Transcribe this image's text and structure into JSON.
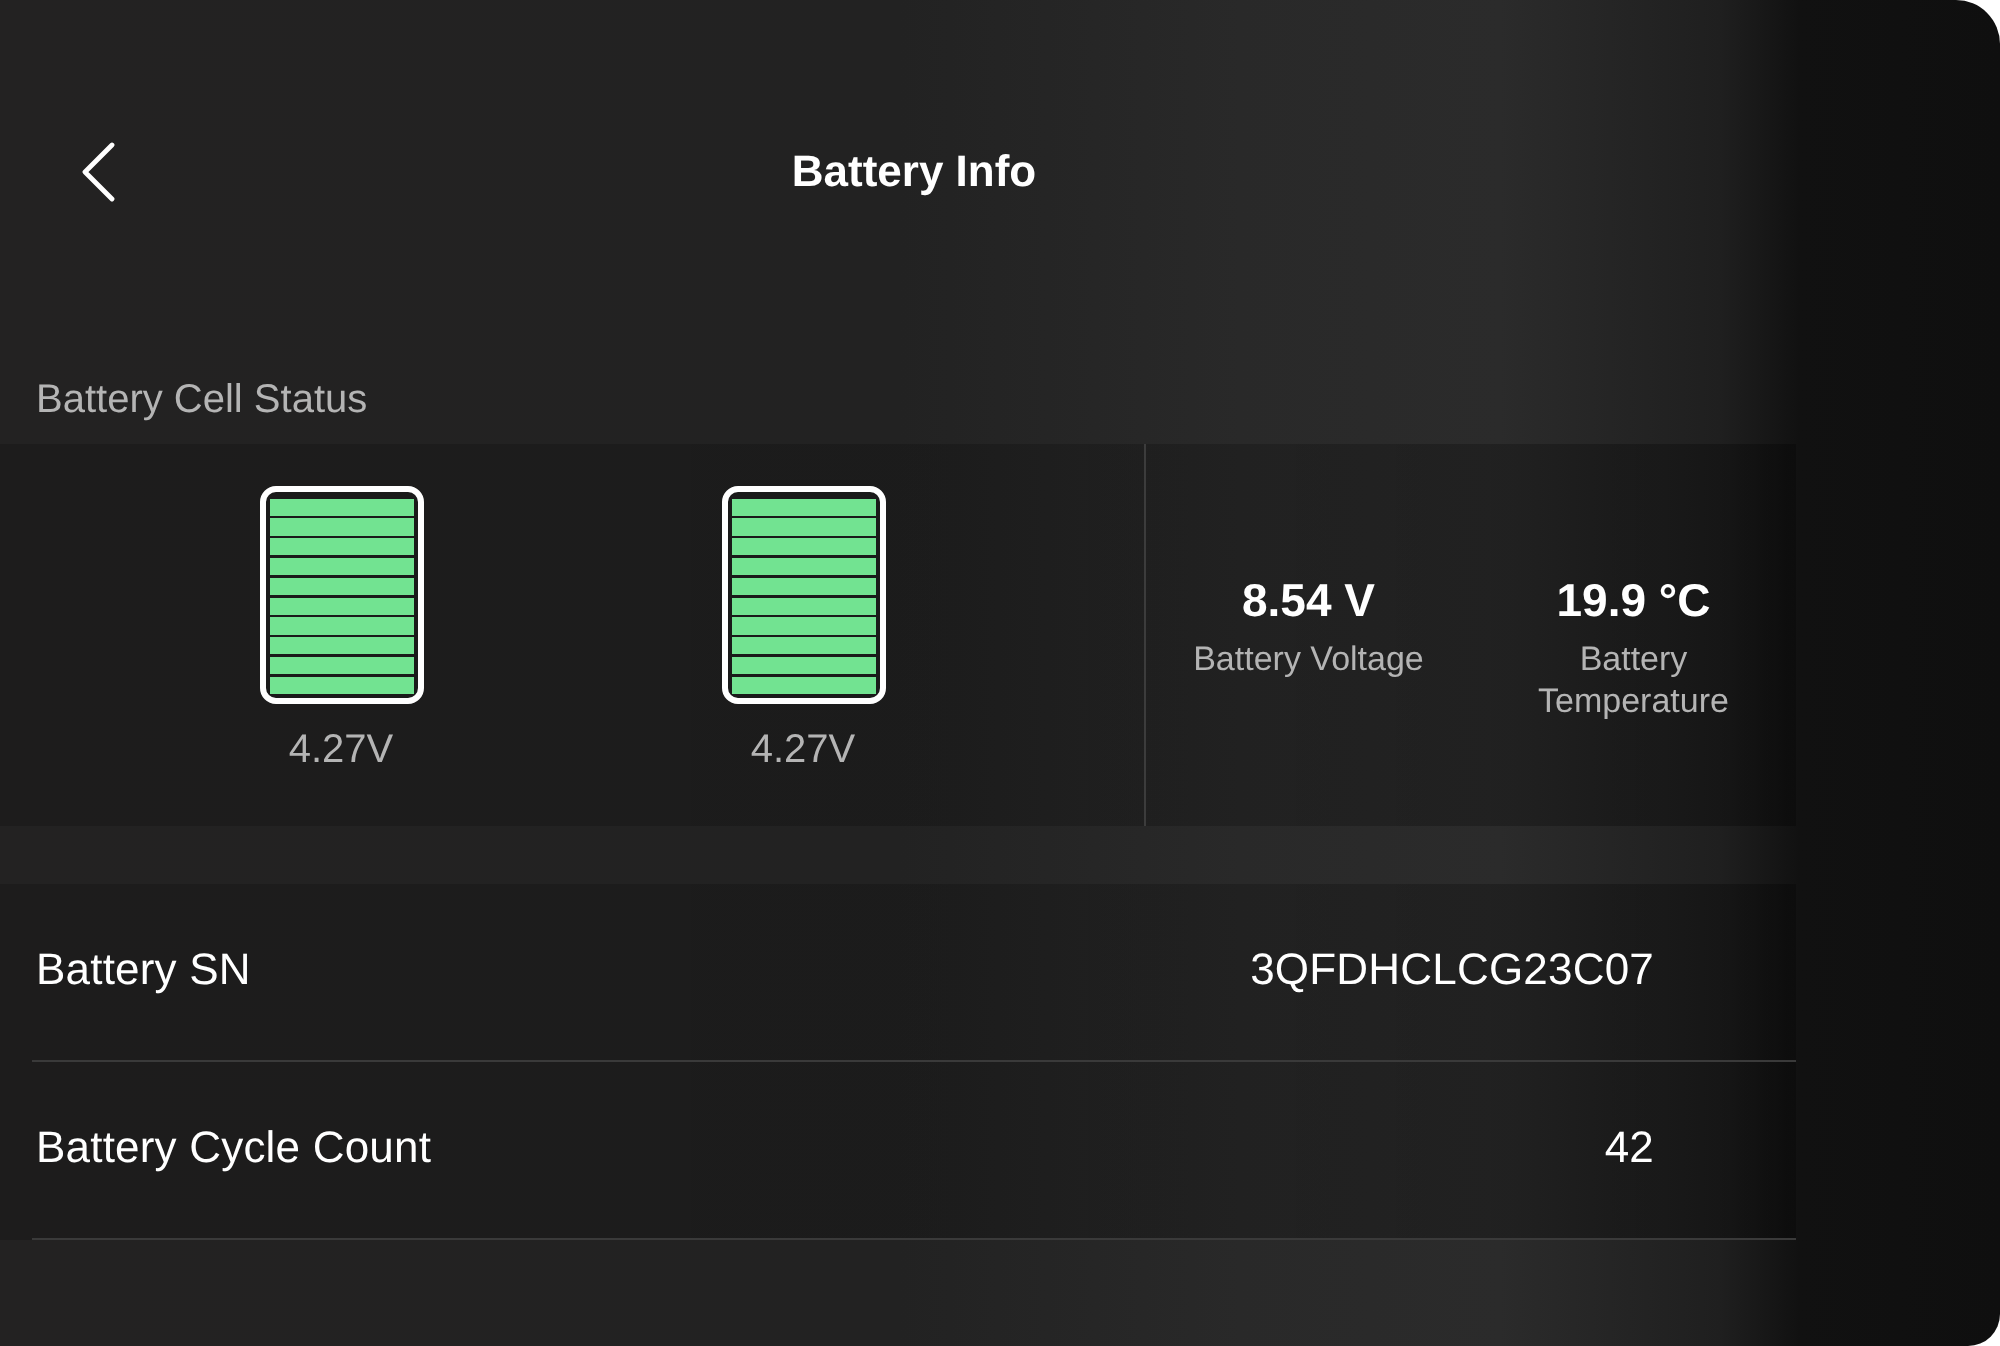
{
  "header": {
    "title": "Battery Info"
  },
  "cell_status": {
    "label": "Battery Cell Status",
    "cells": [
      {
        "level": 1,
        "voltage": "4.27V"
      },
      {
        "level": 1,
        "voltage": "4.27V"
      }
    ],
    "stats": [
      {
        "value": "8.54 V",
        "label": "Battery Voltage"
      },
      {
        "value": "19.9 °C",
        "label": "Battery Temperature"
      }
    ]
  },
  "info_rows": [
    {
      "label": "Battery SN",
      "value": "3QFDHCLCG23C07"
    },
    {
      "label": "Battery Cycle Count",
      "value": "42"
    }
  ]
}
